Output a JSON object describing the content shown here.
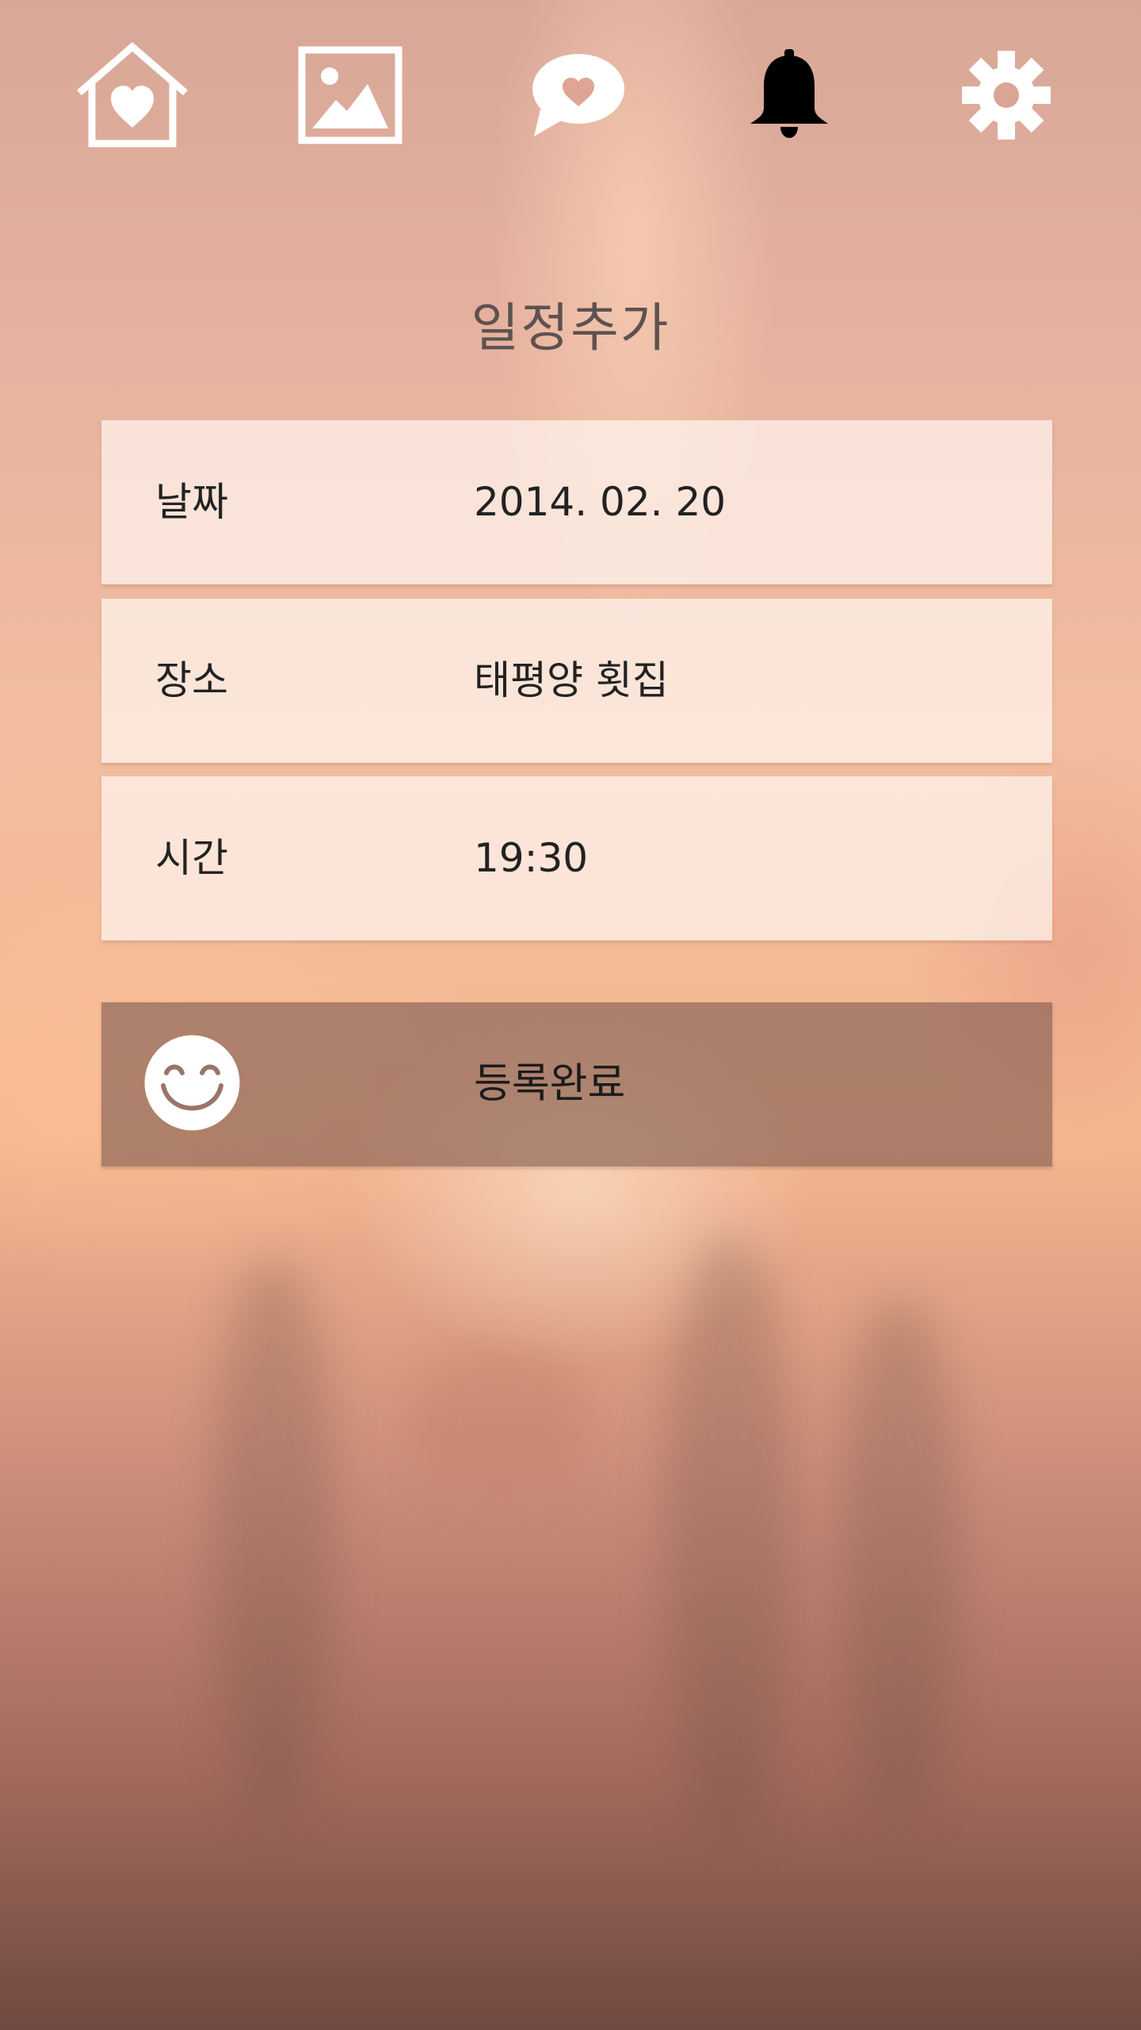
{
  "nav": {
    "items": [
      {
        "name": "home",
        "icon": "home-heart-icon",
        "active": false
      },
      {
        "name": "gallery",
        "icon": "image-icon",
        "active": false
      },
      {
        "name": "chat",
        "icon": "speech-bubble-heart-icon",
        "active": false
      },
      {
        "name": "notifications",
        "icon": "bell-icon",
        "active": true
      },
      {
        "name": "settings",
        "icon": "gear-icon",
        "active": false
      }
    ],
    "inactive_color": "#ffffff",
    "active_color": "#000000"
  },
  "page": {
    "title": "일정추가"
  },
  "form": {
    "date": {
      "label": "날짜",
      "value": "2014. 02. 20"
    },
    "place": {
      "label": "장소",
      "value": "태평양 횟집"
    },
    "time": {
      "label": "시간",
      "value": "19:30"
    }
  },
  "submit": {
    "label": "등록완료",
    "icon": "smiley-face-icon"
  },
  "colors": {
    "row_background": "#fbeee8",
    "submit_background": "#9b7466",
    "text": "#222222"
  }
}
